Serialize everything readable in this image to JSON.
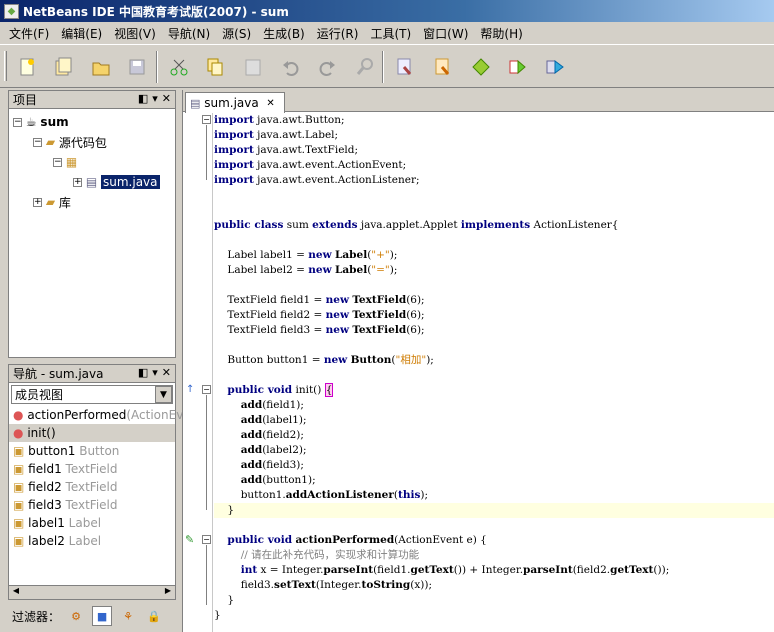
{
  "window": {
    "title": "NetBeans IDE 中国教育考试版(2007) - sum"
  },
  "menu": [
    "文件(F)",
    "编辑(E)",
    "视图(V)",
    "导航(N)",
    "源(S)",
    "生成(B)",
    "运行(R)",
    "工具(T)",
    "窗口(W)",
    "帮助(H)"
  ],
  "toolbar": {
    "icons": [
      "new-file-icon",
      "new-project-icon",
      "open-project-icon",
      "save-all-icon",
      "cut-icon",
      "copy-icon",
      "paste-icon",
      "undo-icon",
      "redo-icon",
      "find-icon",
      "build-icon",
      "clean-build-icon",
      "run-icon",
      "debug-icon",
      "step-icon"
    ]
  },
  "projects": {
    "title": "项目",
    "nodes": [
      "sum",
      "源代码包",
      "sum.java",
      "库"
    ]
  },
  "navigator": {
    "title": "导航 - sum.java",
    "view": "成员视图",
    "items": [
      {
        "name": "actionPerformed",
        "type": "(ActionEve",
        "kind": "method"
      },
      {
        "name": "init()",
        "type": "",
        "kind": "method"
      },
      {
        "name": "button1",
        "type": "Button",
        "kind": "field"
      },
      {
        "name": "field1",
        "type": "TextField",
        "kind": "field"
      },
      {
        "name": "field2",
        "type": "TextField",
        "kind": "field"
      },
      {
        "name": "field3",
        "type": "TextField",
        "kind": "field"
      },
      {
        "name": "label1",
        "type": "Label",
        "kind": "field"
      },
      {
        "name": "label2",
        "type": "Label",
        "kind": "field"
      }
    ],
    "filter_label": "过滤器："
  },
  "editor": {
    "tab": "sum.java",
    "lines": [
      "import java.awt.Button;",
      "import java.awt.Label;",
      "import java.awt.TextField;",
      "import java.awt.event.ActionEvent;",
      "import java.awt.event.ActionListener;",
      "",
      "",
      "public class sum extends java.applet.Applet implements ActionListener{",
      "",
      "    Label label1 = new Label(\"+\");",
      "    Label label2 = new Label(\"=\");",
      "",
      "    TextField field1 = new TextField(6);",
      "    TextField field2 = new TextField(6);",
      "    TextField field3 = new TextField(6);",
      "",
      "    Button button1 = new Button(\"相加\");",
      "",
      "    public void init() {",
      "        add(field1);",
      "        add(label1);",
      "        add(field2);",
      "        add(label2);",
      "        add(field3);",
      "        add(button1);",
      "        button1.addActionListener(this);",
      "    }",
      "",
      "    public void actionPerformed(ActionEvent e) {",
      "        // 请在此补充代码，实现求和计算功能",
      "        int x = Integer.parseInt(field1.getText()) + Integer.parseInt(field2.getText());",
      "        field3.setText(Integer.toString(x));",
      "    }",
      "}"
    ]
  }
}
